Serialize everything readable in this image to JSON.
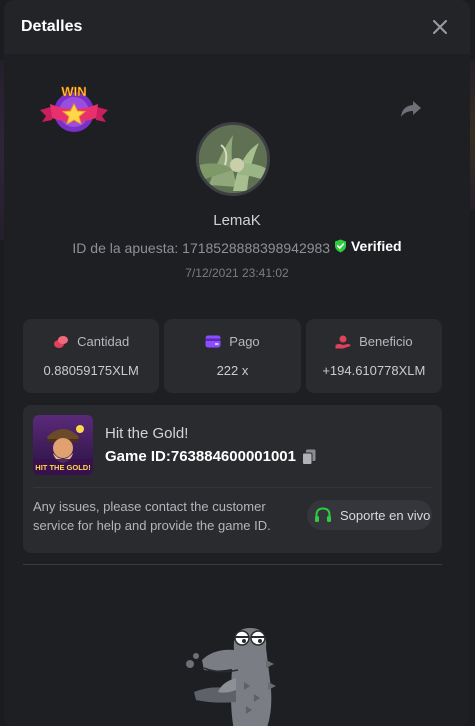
{
  "header": {
    "title": "Detalles"
  },
  "badge": {
    "text": "WIN"
  },
  "bet": {
    "username": "LemaK",
    "id_label": "ID de la apuesta: ",
    "id_value": "1718528888398942983",
    "verified_label": "Verified",
    "timestamp": "7/12/2021 23:41:02"
  },
  "stats": [
    {
      "label": "Cantidad",
      "value": "0.88059175XLM",
      "icon": "coins-icon",
      "color": "#e0405a"
    },
    {
      "label": "Pago",
      "value": "222 x",
      "icon": "card-icon",
      "color": "#8b4dff"
    },
    {
      "label": "Beneficio",
      "value": "+194.610778XLM",
      "icon": "hand-coin-icon",
      "color": "#e0405a"
    }
  ],
  "game": {
    "thumb_text": "HIT THE GOLD!",
    "title": "Hit the Gold!",
    "id_label": "Game ID:",
    "id_value": "763884600001001",
    "help_text": "Any issues, please contact the customer service for help and provide the game ID.",
    "support_label": "Soporte en vivo"
  },
  "colors": {
    "verified": "#2ecc40",
    "support_icon": "#2ecc40",
    "accent": "#e0405a"
  }
}
